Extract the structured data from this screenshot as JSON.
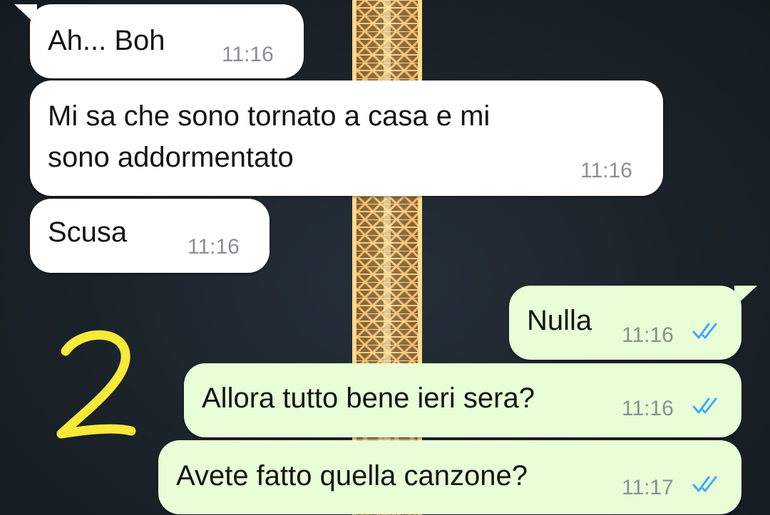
{
  "chat": {
    "messages": [
      {
        "direction": "incoming",
        "text": "Ah... Boh",
        "time": "11:16"
      },
      {
        "direction": "incoming",
        "text": "Mi sa che sono tornato a casa e mi\nsono addormentato",
        "time": "11:16"
      },
      {
        "direction": "incoming",
        "text": "Scusa",
        "time": "11:16"
      },
      {
        "direction": "outgoing",
        "text": "Nulla",
        "time": "11:16",
        "status": "read"
      },
      {
        "direction": "outgoing",
        "text": "Allora tutto bene ieri sera?",
        "time": "11:16",
        "status": "read"
      },
      {
        "direction": "outgoing",
        "text": "Avete fatto quella canzone?",
        "time": "11:17",
        "status": "read"
      }
    ]
  },
  "annotation": {
    "mark": "2",
    "color": "#f6e93a"
  },
  "colors": {
    "incoming_bubble": "#ffffff",
    "outgoing_bubble": "#e7fed6",
    "read_ticks": "#3fa9f5",
    "tower_lights": "#e9b25a"
  },
  "icons": {
    "read_receipt": "double-check-icon"
  }
}
